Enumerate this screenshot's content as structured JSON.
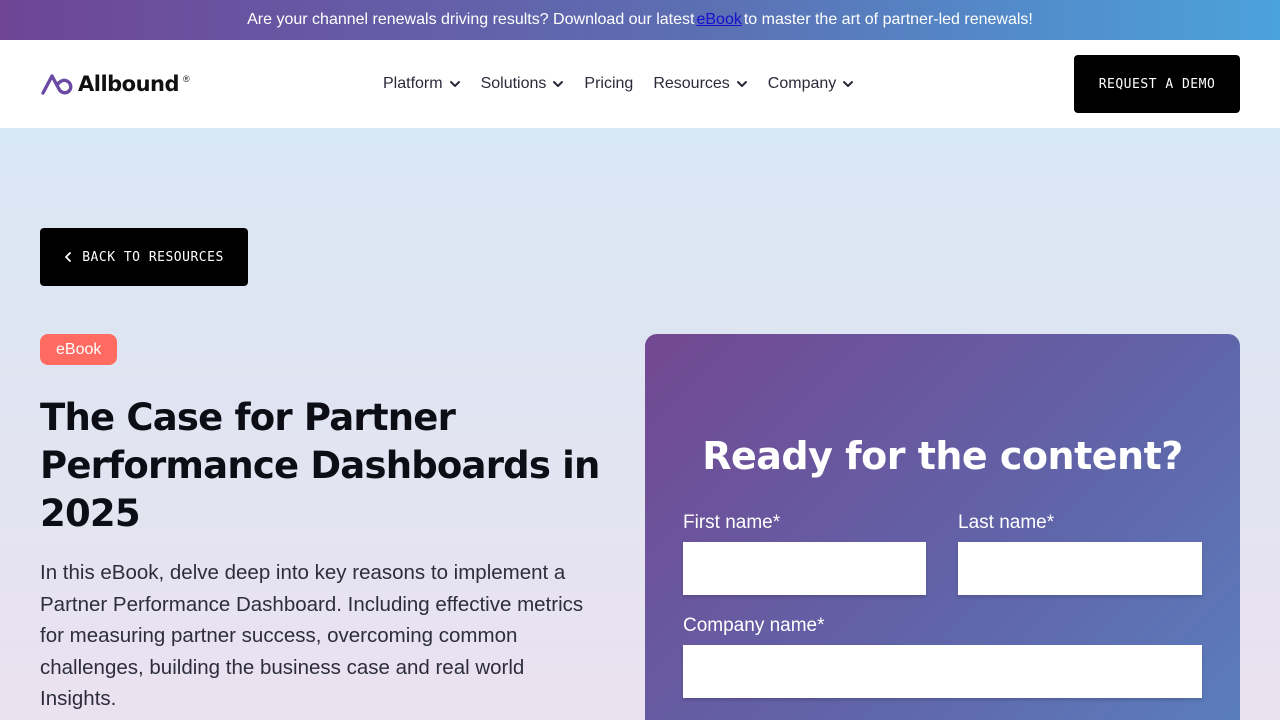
{
  "announcement": {
    "text_before": "Are your channel renewals driving results? Download our latest",
    "link_text": "eBook",
    "text_after": "to master the art of partner-led renewals!"
  },
  "header": {
    "logo_text": "Allbound",
    "logo_mark": "®",
    "nav": [
      {
        "label": "Platform",
        "has_dropdown": true
      },
      {
        "label": "Solutions",
        "has_dropdown": true
      },
      {
        "label": "Pricing",
        "has_dropdown": false
      },
      {
        "label": "Resources",
        "has_dropdown": true
      },
      {
        "label": "Company",
        "has_dropdown": true
      }
    ],
    "cta_label": "REQUEST A DEMO"
  },
  "hero": {
    "back_label": "BACK TO RESOURCES",
    "badge": "eBook",
    "title": "The Case for Partner Performance Dashboards in 2025",
    "description": "In this eBook, delve deep into key reasons to implement a Partner Performance Dashboard. Including effective metrics for measuring partner success, overcoming common challenges, building the business case and real world Insights."
  },
  "form": {
    "heading": "Ready for the content?",
    "first_name_label": "First name*",
    "first_name_value": "",
    "last_name_label": "Last name*",
    "last_name_value": "",
    "company_label": "Company name*",
    "company_value": ""
  },
  "colors": {
    "badge": "#ff6a61",
    "cta_bg": "#000000",
    "form_gradient_start": "#734892",
    "form_gradient_end": "#5a7fbe"
  }
}
